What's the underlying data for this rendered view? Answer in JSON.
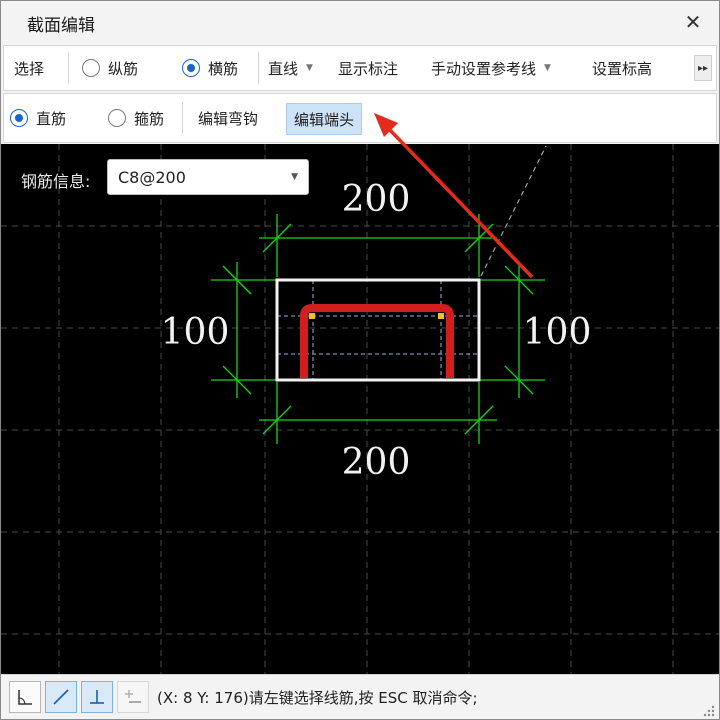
{
  "window": {
    "title": "截面编辑",
    "close_glyph": "✕"
  },
  "toolbar1": {
    "select_label": "选择",
    "longitudinal_label": "纵筋",
    "transverse_label": "横筋",
    "line_type_value": "直线",
    "show_annotation_label": "显示标注",
    "manual_ref_line_label": "手动设置参考线",
    "set_elevation_label": "设置标高",
    "more_glyph": "▸▸"
  },
  "toolbar2": {
    "straight_label": "直筋",
    "stirrup_label": "箍筋",
    "edit_hook_label": "编辑弯钩",
    "edit_end_label": "编辑端头"
  },
  "canvas": {
    "rebar_info_label": "钢筋信息:",
    "rebar_info_value": "C8@200",
    "dims": {
      "top": "200",
      "bottom": "200",
      "left": "100",
      "right": "100"
    },
    "colors": {
      "dimension": "#18d418",
      "rebar": "#d11f1f",
      "section": "#f2f2f2",
      "arrow": "#e52a1e"
    }
  },
  "statusbar": {
    "status_text": "(X: 8 Y: 176)请左键选择线筋,按 ESC 取消命令;"
  }
}
